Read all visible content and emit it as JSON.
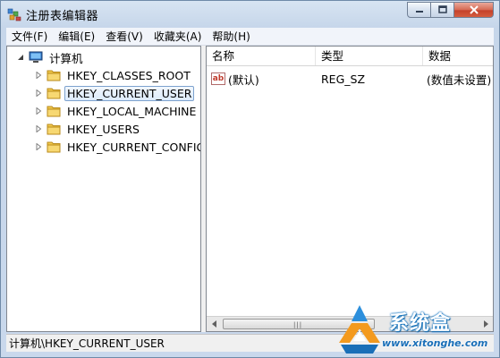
{
  "window": {
    "title": "注册表编辑器",
    "buttons": {
      "minimize": "minimize",
      "maximize": "maximize",
      "close": "close"
    }
  },
  "menu": [
    "文件(F)",
    "编辑(E)",
    "查看(V)",
    "收藏夹(A)",
    "帮助(H)"
  ],
  "tree": {
    "root": "计算机",
    "items": [
      {
        "label": "HKEY_CLASSES_ROOT",
        "selected": false
      },
      {
        "label": "HKEY_CURRENT_USER",
        "selected": true
      },
      {
        "label": "HKEY_LOCAL_MACHINE",
        "selected": false
      },
      {
        "label": "HKEY_USERS",
        "selected": false
      },
      {
        "label": "HKEY_CURRENT_CONFIG",
        "selected": false
      }
    ]
  },
  "list": {
    "columns": {
      "name": "名称",
      "type": "类型",
      "data": "数据"
    },
    "rows": [
      {
        "icon": "ab",
        "name": "(默认)",
        "type": "REG_SZ",
        "data": "(数值未设置)"
      }
    ]
  },
  "status": "计算机\\HKEY_CURRENT_USER",
  "watermark": {
    "title": "系统盒",
    "url": "www.xitonghe.com"
  },
  "colors": {
    "accent": "#1a79c4",
    "folder": "#f2c94c",
    "close": "#c5412a",
    "selection": "#dcebfc"
  }
}
